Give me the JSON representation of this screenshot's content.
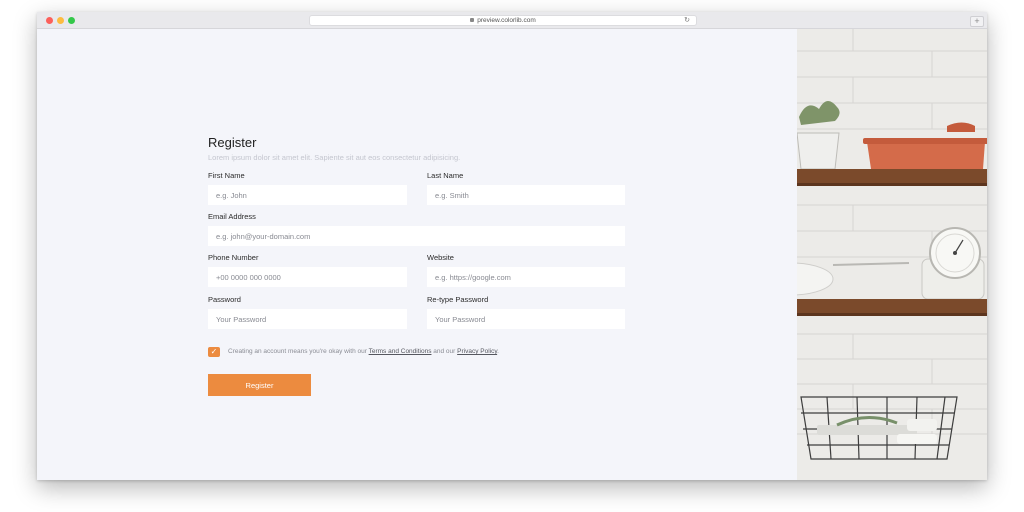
{
  "browser": {
    "url": "preview.colorlib.com",
    "new_tab_label": "+"
  },
  "form": {
    "title": "Register",
    "subtitle": "Lorem ipsum dolor sit amet elit. Sapiente sit aut eos consectetur adipisicing.",
    "fields": {
      "first_name": {
        "label": "First Name",
        "placeholder": "e.g. John"
      },
      "last_name": {
        "label": "Last Name",
        "placeholder": "e.g. Smith"
      },
      "email": {
        "label": "Email Address",
        "placeholder": "e.g. john@your-domain.com"
      },
      "phone": {
        "label": "Phone Number",
        "placeholder": "+00 0000 000 0000"
      },
      "website": {
        "label": "Website",
        "placeholder": "e.g. https://google.com"
      },
      "password": {
        "label": "Password",
        "placeholder": "Your Password"
      },
      "retype_password": {
        "label": "Re-type Password",
        "placeholder": "Your Password"
      }
    },
    "consent": {
      "checked": true,
      "text_before": "Creating an account means you're okay with our ",
      "terms_link": "Terms and Conditions",
      "text_middle": " and our ",
      "privacy_link": "Privacy Policy",
      "text_after": "."
    },
    "submit_label": "Register"
  },
  "colors": {
    "accent": "#ec8b3f",
    "page_background": "#f4f5fa",
    "input_background": "#ffffff"
  },
  "icons": {
    "lock": "lock-icon",
    "reload": "reload-icon",
    "check": "checkmark-icon"
  }
}
